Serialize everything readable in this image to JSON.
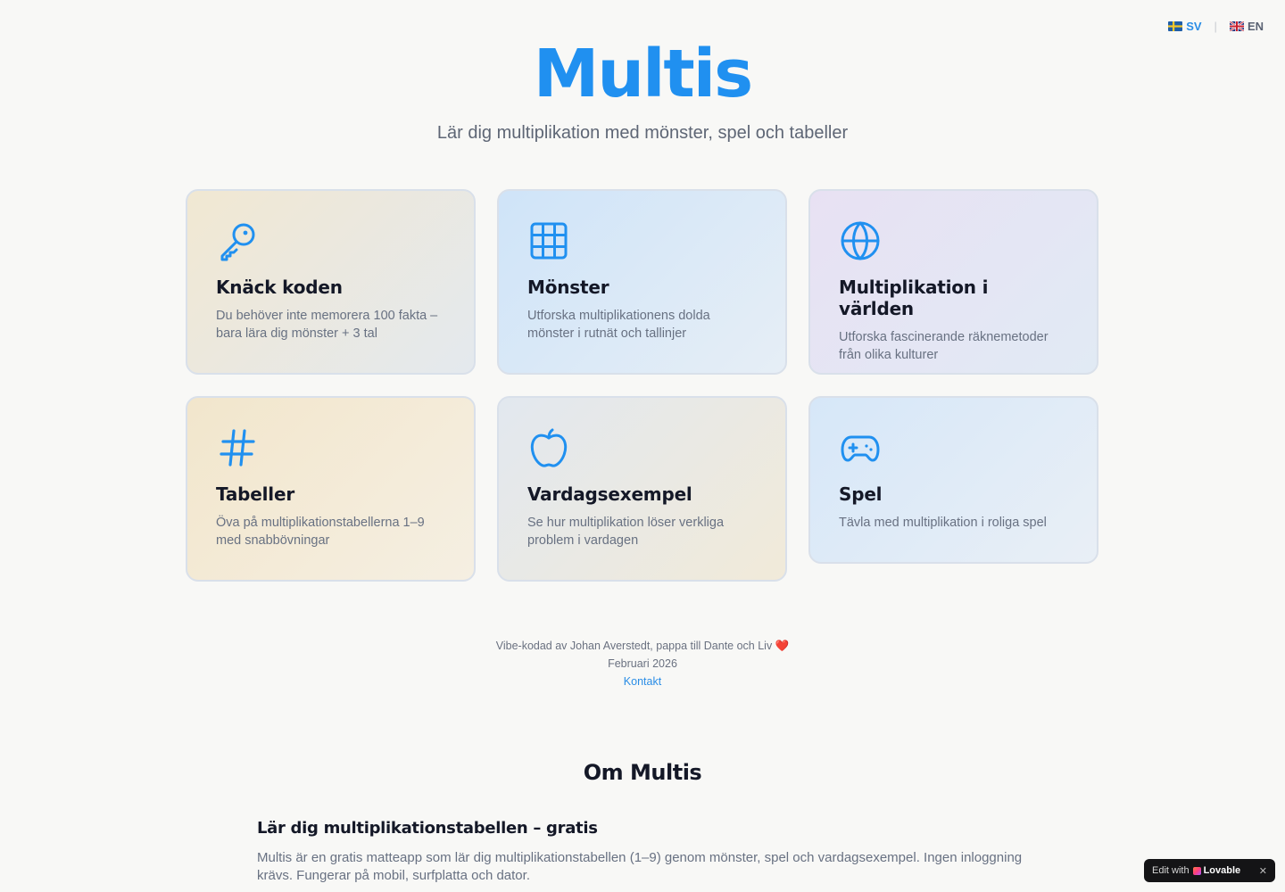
{
  "lang": {
    "sv_label": "SV",
    "en_label": "EN",
    "separator": "|"
  },
  "header": {
    "title": "Multis",
    "subtitle": "Lär dig multiplikation med mönster, spel och tabeller"
  },
  "cards": [
    {
      "icon": "key-icon",
      "title": "Knäck koden",
      "desc": "Du behöver inte memorera 100 fakta – bara lära dig mönster + 3 tal"
    },
    {
      "icon": "grid-icon",
      "title": "Mönster",
      "desc": "Utforska multiplikationens dolda mönster i rutnät och tallinjer"
    },
    {
      "icon": "globe-icon",
      "title": "Multiplikation i världen",
      "desc": "Utforska fascinerande räknemetoder från olika kulturer"
    },
    {
      "icon": "hash-icon",
      "title": "Tabeller",
      "desc": "Öva på multiplikationstabellerna 1–9 med snabbövningar"
    },
    {
      "icon": "apple-icon",
      "title": "Vardagsexempel",
      "desc": "Se hur multiplikation löser verkliga problem i vardagen"
    },
    {
      "icon": "gamepad-icon",
      "title": "Spel",
      "desc": "Tävla med multiplikation i roliga spel"
    }
  ],
  "footer": {
    "credit": "Vibe-kodad av Johan Averstedt, pappa till Dante och Liv",
    "heart": "❤️",
    "date": "Februari 2026",
    "contact": "Kontakt"
  },
  "about": {
    "title": "Om Multis",
    "heading": "Lär dig multiplikationstabellen – gratis",
    "text": "Multis är en gratis matteapp som lär dig multiplikationstabellen (1–9) genom mönster, spel och vardagsexempel. Ingen inloggning krävs. Fungerar på mobil, surfplatta och dator."
  },
  "badge": {
    "prefix": "Edit with",
    "brand": "Lovable",
    "close": "✕"
  },
  "colors": {
    "accent": "#2090f0",
    "text": "#141827",
    "muted": "#687182",
    "background": "#f8f8f6"
  }
}
